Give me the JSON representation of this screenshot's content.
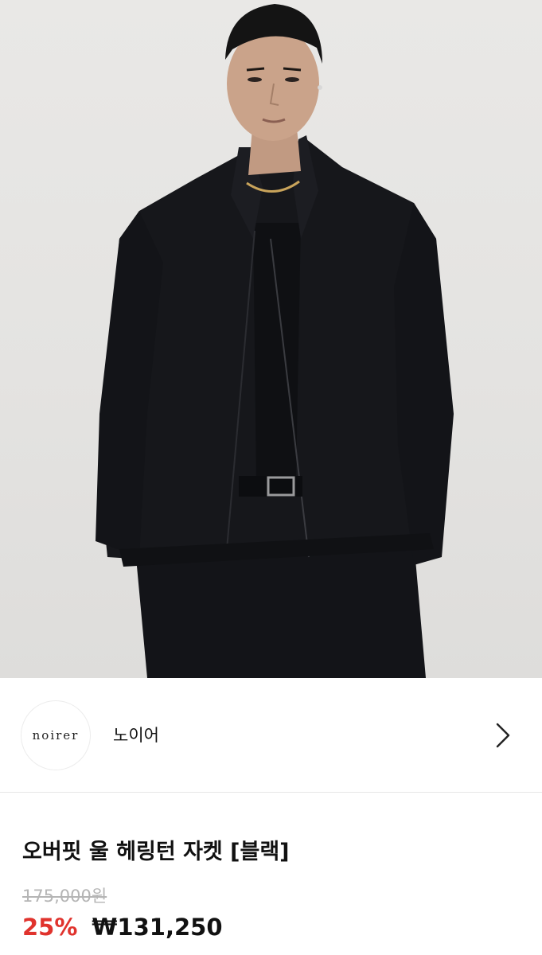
{
  "hero": {
    "image": "product-photo-man-black-jacket",
    "colors": {
      "background": "#e6e5e3",
      "garment": "#15161a",
      "skin": "#c79f86"
    }
  },
  "brand": {
    "logo_text": "noirer",
    "name": "노이어",
    "arrow_icon": "chevron-right-icon"
  },
  "product": {
    "title": "오버핏 울 헤링턴 자켓 [블랙]",
    "original_price": "175,000원",
    "discount": "25%",
    "sale_price": "₩131,250"
  },
  "colors": {
    "discount": "#e0332d",
    "strike": "#b5b5b5",
    "divider": "#e6e6e6"
  }
}
